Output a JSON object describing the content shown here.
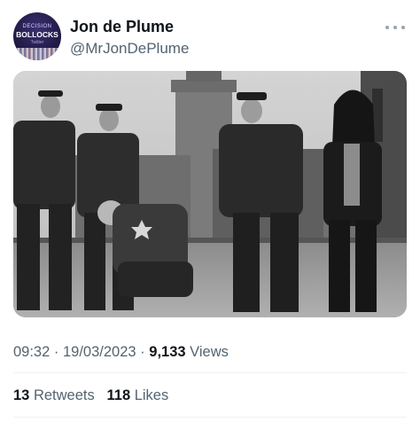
{
  "author": {
    "display_name": "Jon de Plume",
    "handle": "@MrJonDePlume",
    "avatar": {
      "line1": "DECISION",
      "line2": "BOLLOCKS",
      "line3": "Twitter"
    }
  },
  "more_icon": "more-horizontal-icon",
  "tweet": {
    "time": "09:32",
    "separator": "·",
    "date": "19/03/2023",
    "views_count": "9,133",
    "views_label": "Views"
  },
  "stats": {
    "retweets_count": "13",
    "retweets_label": "Retweets",
    "likes_count": "118",
    "likes_label": "Likes"
  },
  "colors": {
    "text_primary": "#0f1419",
    "text_secondary": "#536471",
    "divider": "#eff3f4"
  }
}
